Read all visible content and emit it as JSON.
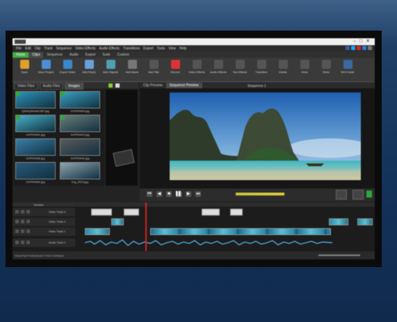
{
  "app": {
    "menu": [
      "File",
      "Edit",
      "Clip",
      "Track",
      "Sequence",
      "Video Effects",
      "Audio Effects",
      "Transitions",
      "Export",
      "Tools",
      "View",
      "Help"
    ],
    "tabs": [
      "Home",
      "Clips",
      "Sequence",
      "Audio",
      "Export",
      "Suite",
      "Custom"
    ]
  },
  "ribbon": {
    "buttons": [
      {
        "label": "Open",
        "icon": "folder-icon",
        "color": "#e0a02a"
      },
      {
        "label": "Save Project",
        "icon": "save-icon",
        "color": "#4b8fd6"
      },
      {
        "label": "Export Video",
        "icon": "export-icon",
        "color": "#3a88c8"
      },
      {
        "label": "Add File(s)",
        "icon": "add-file-icon",
        "color": "#6aa0d8"
      },
      {
        "label": "Add Objects",
        "icon": "add-objects-icon",
        "color": "#4fa0b0"
      },
      {
        "label": "Add Blank",
        "icon": "add-blank-icon",
        "color": "#777"
      },
      {
        "label": "Add Title",
        "icon": "add-title-icon",
        "color": "#555"
      },
      {
        "label": "Record",
        "icon": "record-icon",
        "color": "#d33"
      },
      {
        "label": "Video Effects",
        "icon": "video-effects-icon",
        "color": "#555"
      },
      {
        "label": "Audio Effects",
        "icon": "audio-effects-icon",
        "color": "#555"
      },
      {
        "label": "Text Effects",
        "icon": "text-effects-icon",
        "color": "#555"
      },
      {
        "label": "Transition",
        "icon": "transition-icon",
        "color": "#555"
      },
      {
        "label": "Delete",
        "icon": "delete-icon",
        "color": "#555"
      },
      {
        "label": "Undo",
        "icon": "undo-icon",
        "color": "#555"
      },
      {
        "label": "Redo",
        "icon": "redo-icon",
        "color": "#555"
      },
      {
        "label": "NCH Suite",
        "icon": "nch-suite-icon",
        "color": "#3a6aa0"
      }
    ]
  },
  "bin": {
    "tabs": [
      "Video Files",
      "Audio Files",
      "Images"
    ],
    "selected_tab": "Images",
    "files": [
      {
        "name": "Q54AQ4AAAC0BT.jpg",
        "checked": true,
        "color": "#2c93b8"
      },
      {
        "name": "GOPR0459.jpg",
        "checked": true,
        "color": "#3aa0c4"
      },
      {
        "name": "GOPR0391.jpg",
        "checked": true,
        "color": "#48b0c8"
      },
      {
        "name": "GOPR0420.jpg",
        "checked": true,
        "color": "#6b7e78"
      },
      {
        "name": "GOPR0398.jpg",
        "checked": false,
        "color": "#3a7ea8"
      },
      {
        "name": "GOPR0440.jpg",
        "checked": false,
        "color": "#5a5a5a"
      },
      {
        "name": "GOPR0460.jpg",
        "checked": false,
        "color": "#2a5a7a"
      },
      {
        "name": "img_0023.jpg",
        "checked": false,
        "color": "#8fa4b0"
      }
    ]
  },
  "viewer": {
    "tabs": [
      "Clip Preview",
      "Sequence Preview"
    ],
    "selected_tab": "Sequence Preview",
    "sequence_label": "Sequence 1"
  },
  "timeline": {
    "header_label": "Timeline",
    "tracks": [
      "Video Track 3",
      "Video Track 2",
      "Video Track 1",
      "Audio Track 1"
    ]
  },
  "status_bar": {
    "text": "VideoPad Professional © NCH Software"
  }
}
